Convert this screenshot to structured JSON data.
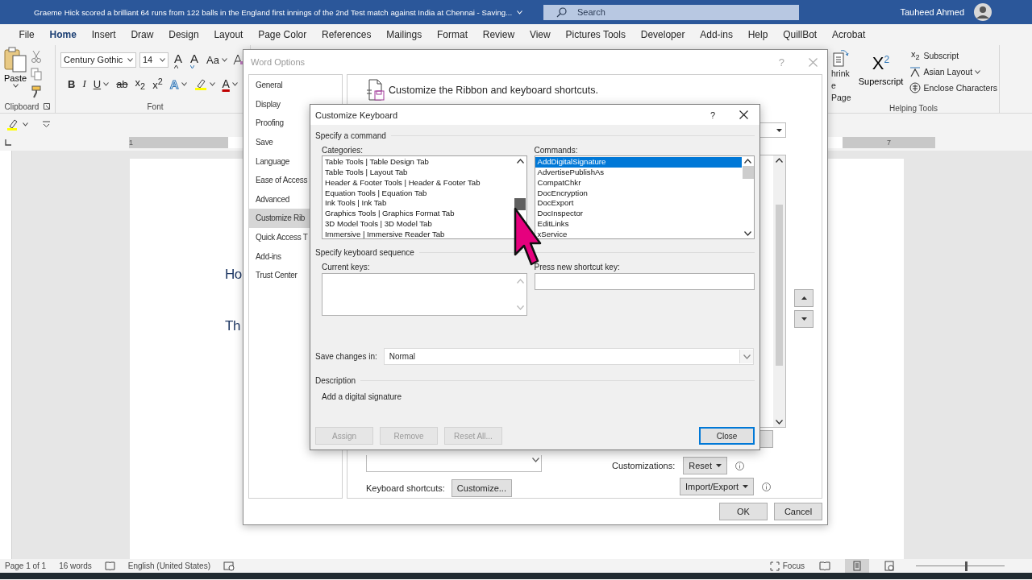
{
  "title_bar": {
    "document_title": "Graeme Hick scored a brilliant 64 runs from 122 balls in the England first innings of the 2nd Test match against India at Chennai  -  Saving...",
    "search": {
      "placeholder": "Search"
    },
    "user_name": "Tauheed Ahmed"
  },
  "ribbon_tabs": [
    {
      "label": "File",
      "selected": false
    },
    {
      "label": "Home",
      "selected": true
    },
    {
      "label": "Insert",
      "selected": false
    },
    {
      "label": "Draw",
      "selected": false
    },
    {
      "label": "Design",
      "selected": false
    },
    {
      "label": "Layout",
      "selected": false
    },
    {
      "label": "Page Color",
      "selected": false
    },
    {
      "label": "References",
      "selected": false
    },
    {
      "label": "Mailings",
      "selected": false
    },
    {
      "label": "Format",
      "selected": false
    },
    {
      "label": "Review",
      "selected": false
    },
    {
      "label": "View",
      "selected": false
    },
    {
      "label": "Pictures Tools",
      "selected": false
    },
    {
      "label": "Developer",
      "selected": false
    },
    {
      "label": "Add-ins",
      "selected": false
    },
    {
      "label": "Help",
      "selected": false
    },
    {
      "label": "QuillBot",
      "selected": false
    },
    {
      "label": "Acrobat",
      "selected": false
    }
  ],
  "ribbon": {
    "clipboard": {
      "paste_label": "Paste",
      "group_label": "Clipboard"
    },
    "font": {
      "font_name": "Century Gothic",
      "font_size": "14",
      "group_label": "Font",
      "top_buttons": [
        {
          "kind": "grow",
          "text": "A"
        },
        {
          "kind": "shrink",
          "text": "A"
        },
        {
          "kind": "case",
          "text": "Aa"
        }
      ],
      "bottom_buttons": [
        {
          "kind": "bold",
          "text": "B"
        },
        {
          "kind": "italic",
          "text": "I"
        },
        {
          "kind": "underline",
          "text": "U"
        },
        {
          "kind": "strike",
          "text": "ab"
        },
        {
          "kind": "subscript",
          "text": "x$_{2}$"
        },
        {
          "kind": "superscript",
          "text": "x$^{2}$"
        },
        {
          "kind": "effects",
          "text": "A"
        },
        {
          "kind": "highlight"
        },
        {
          "kind": "color",
          "text": "A"
        }
      ]
    },
    "helping_tools": {
      "shrink_lines": [
        "hrink",
        "e Page"
      ],
      "superscript_glyph": "X$^{2}$",
      "superscript_label": "Superscript",
      "small_commands": [
        {
          "kind": "subscript",
          "icon_text": "x$_{2}$",
          "label": "Subscript",
          "dropdown": false
        },
        {
          "kind": "asian",
          "label": "Asian Layout",
          "dropdown": true
        },
        {
          "kind": "enclose",
          "label": "Enclose Characters",
          "dropdown": false
        }
      ],
      "group_label": "Helping Tools"
    }
  },
  "ruler": {
    "left_number": "1",
    "right_number": "7"
  },
  "document": {
    "lines": [
      "Ho",
      "Th"
    ]
  },
  "word_options": {
    "title": "Word Options",
    "help_glyph": "?",
    "nav": [
      {
        "label": "General",
        "selected": false
      },
      {
        "label": "Display",
        "selected": false
      },
      {
        "label": "Proofing",
        "selected": false
      },
      {
        "label": "Save",
        "selected": false
      },
      {
        "label": "Language",
        "selected": false
      },
      {
        "label": "Ease of Access",
        "selected": false
      },
      {
        "label": "Advanced",
        "selected": false
      },
      {
        "label": "Customize Rib",
        "selected": true
      },
      {
        "label": "Quick Access T",
        "selected": false
      },
      {
        "label": "Add-ins",
        "selected": false
      },
      {
        "label": "Trust Center",
        "selected": false
      }
    ],
    "heading": "Customize the Ribbon and keyboard shortcuts.",
    "keyboard_shortcuts_label": "Keyboard shortcuts:",
    "customize_button": "Customize...",
    "customizations_label": "Customizations:",
    "reset_button": "Reset",
    "import_export_button": "Import/Export",
    "buttons": [
      {
        "label": "OK"
      },
      {
        "label": "Cancel"
      }
    ]
  },
  "customize_keyboard": {
    "title": "Customize Keyboard",
    "help_glyph": "?",
    "command_section": "Specify a command",
    "categories_label": "Categories:",
    "categories": [
      {
        "label": "Table Tools | Table Design Tab",
        "selected": false
      },
      {
        "label": "Table Tools | Layout Tab",
        "selected": false
      },
      {
        "label": "Header & Footer Tools | Header & Footer Tab",
        "selected": false
      },
      {
        "label": "Equation Tools | Equation Tab",
        "selected": false
      },
      {
        "label": "Ink Tools | Ink Tab",
        "selected": false
      },
      {
        "label": "Graphics Tools | Graphics Format Tab",
        "selected": false
      },
      {
        "label": "3D Model Tools | 3D Model Tab",
        "selected": false
      },
      {
        "label": "Immersive | Immersive Reader Tab",
        "selected": false
      }
    ],
    "commands_label": "Commands:",
    "commands": [
      {
        "label": "AddDigitalSignature",
        "selected": true
      },
      {
        "label": "AdvertisePublishAs",
        "selected": false
      },
      {
        "label": "CompatChkr",
        "selected": false
      },
      {
        "label": "DocEncryption",
        "selected": false
      },
      {
        "label": "DocExport",
        "selected": false
      },
      {
        "label": "DocInspector",
        "selected": false
      },
      {
        "label": "EditLinks",
        "selected": false
      },
      {
        "label": "xService",
        "selected": false
      }
    ],
    "sequence_section": "Specify keyboard sequence",
    "current_keys_label": "Current keys:",
    "new_key_label": "Press new shortcut key:",
    "save_label": "Save changes in:",
    "save_value": "Normal",
    "description_heading": "Description",
    "description": "Add a digital signature",
    "buttons": [
      {
        "label": "Assign",
        "disabled": true,
        "default": false
      },
      {
        "label": "Remove",
        "disabled": true,
        "default": false
      },
      {
        "label": "Reset All...",
        "disabled": true,
        "default": false
      },
      {
        "label": "Close",
        "disabled": false,
        "default": true
      }
    ]
  },
  "status_bar": {
    "page": "Page 1 of 1",
    "words": "16 words",
    "language": "English (United States)",
    "focus": "Focus",
    "views": [
      {
        "kind": "read",
        "selected": false
      },
      {
        "kind": "print",
        "selected": true
      },
      {
        "kind": "web",
        "selected": false
      }
    ],
    "zoom": {
      "level": 0.55
    }
  }
}
